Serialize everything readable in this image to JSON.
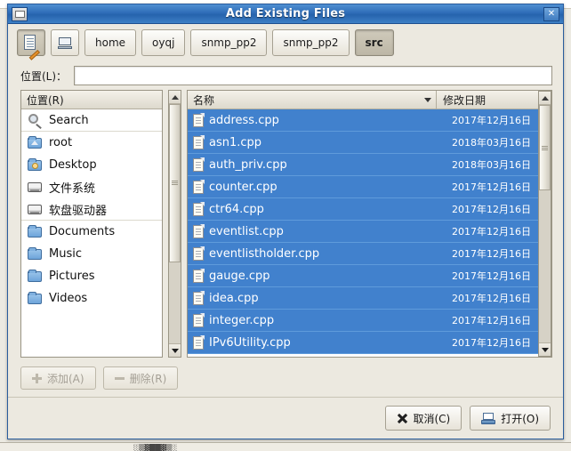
{
  "window": {
    "title": "Add Existing Files",
    "icon": "window-icon",
    "close_label": "✕"
  },
  "pathbar": {
    "edit_location_icon": "document-pencil-icon",
    "computer_icon": "computer-icon",
    "crumbs": [
      {
        "label": "home",
        "active": false
      },
      {
        "label": "oyqj",
        "active": false
      },
      {
        "label": "snmp_pp2",
        "active": false
      },
      {
        "label": "snmp_pp2",
        "active": false
      },
      {
        "label": "src",
        "active": true
      }
    ]
  },
  "location": {
    "label": "位置(L)：",
    "value": "",
    "placeholder": ""
  },
  "places": {
    "header": "位置(R)",
    "items": [
      {
        "label": "Search",
        "icon": "search-icon",
        "separator": true
      },
      {
        "label": "root",
        "icon": "folder-home-icon",
        "separator": false
      },
      {
        "label": "Desktop",
        "icon": "folder-desktop-icon",
        "separator": false
      },
      {
        "label": "文件系统",
        "icon": "drive-icon",
        "separator": false
      },
      {
        "label": "软盘驱动器",
        "icon": "floppy-drive-icon",
        "separator": true
      },
      {
        "label": "Documents",
        "icon": "folder-icon",
        "separator": false
      },
      {
        "label": "Music",
        "icon": "folder-icon",
        "separator": false
      },
      {
        "label": "Pictures",
        "icon": "folder-icon",
        "separator": false
      },
      {
        "label": "Videos",
        "icon": "folder-icon",
        "separator": false
      }
    ]
  },
  "filelist": {
    "columns": [
      {
        "key": "name",
        "label": "名称",
        "sort_icon": "chevron-down-icon"
      },
      {
        "key": "date",
        "label": "修改日期"
      }
    ],
    "rows": [
      {
        "name": "address.cpp",
        "date": "2017年12月16日",
        "selected": true,
        "icon": "file-icon"
      },
      {
        "name": "asn1.cpp",
        "date": "2018年03月16日",
        "selected": true,
        "icon": "file-icon"
      },
      {
        "name": "auth_priv.cpp",
        "date": "2018年03月16日",
        "selected": true,
        "icon": "file-icon"
      },
      {
        "name": "counter.cpp",
        "date": "2017年12月16日",
        "selected": true,
        "icon": "file-icon"
      },
      {
        "name": "ctr64.cpp",
        "date": "2017年12月16日",
        "selected": true,
        "icon": "file-icon"
      },
      {
        "name": "eventlist.cpp",
        "date": "2017年12月16日",
        "selected": true,
        "icon": "file-icon"
      },
      {
        "name": "eventlistholder.cpp",
        "date": "2017年12月16日",
        "selected": true,
        "icon": "file-icon"
      },
      {
        "name": "gauge.cpp",
        "date": "2017年12月16日",
        "selected": true,
        "icon": "file-icon"
      },
      {
        "name": "idea.cpp",
        "date": "2017年12月16日",
        "selected": true,
        "icon": "file-icon"
      },
      {
        "name": "integer.cpp",
        "date": "2017年12月16日",
        "selected": true,
        "icon": "file-icon"
      },
      {
        "name": "IPv6Utility.cpp",
        "date": "2017年12月16日",
        "selected": true,
        "icon": "file-icon"
      }
    ]
  },
  "actions": {
    "add_label": "添加(A)",
    "remove_label": "删除(R)",
    "cancel_label": "取消(C)",
    "open_label": "打开(O)"
  },
  "background": {
    "strip_text": "░▒▓██▓▒░"
  },
  "colors": {
    "titlebar_blue": "#2f6db8",
    "selection_blue": "#4181cd",
    "window_bg": "#ece9e0",
    "list_bg": "#ffffff"
  }
}
